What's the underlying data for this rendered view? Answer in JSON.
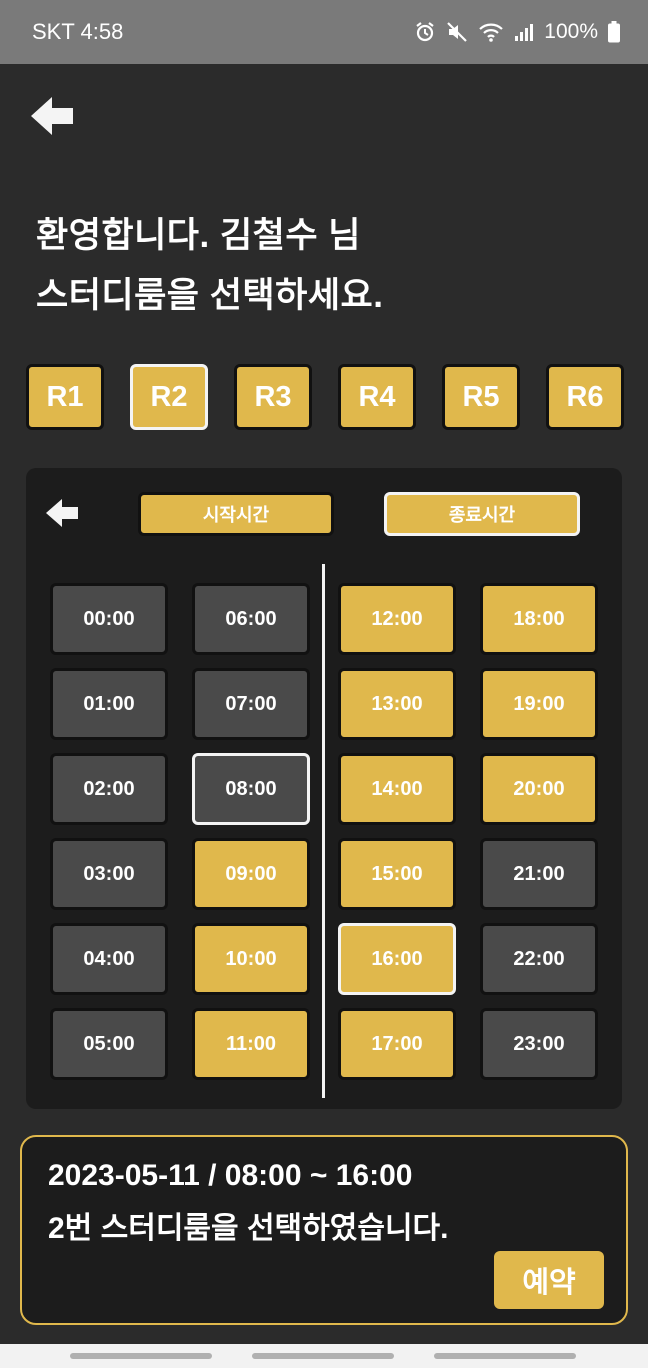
{
  "status_bar": {
    "carrier_time": "SKT 4:58",
    "battery_text": "100%",
    "icons": [
      "alarm-icon",
      "mute-icon",
      "wifi-icon",
      "signal-icon",
      "battery-icon"
    ]
  },
  "header": {
    "back_icon": "arrow-left-icon",
    "welcome_line1": "환영합니다. 김철수 님",
    "welcome_line2": "스터디룸을 선택하세요."
  },
  "rooms": {
    "items": [
      "R1",
      "R2",
      "R3",
      "R4",
      "R5",
      "R6"
    ],
    "selected": "R2"
  },
  "time_panel": {
    "back_icon": "arrow-left-icon",
    "start_tab": "시작시간",
    "end_tab": "종료시간",
    "slots": [
      "00:00",
      "01:00",
      "02:00",
      "03:00",
      "04:00",
      "05:00",
      "06:00",
      "07:00",
      "08:00",
      "09:00",
      "10:00",
      "11:00",
      "12:00",
      "13:00",
      "14:00",
      "15:00",
      "16:00",
      "17:00",
      "18:00",
      "19:00",
      "20:00",
      "21:00",
      "22:00",
      "23:00"
    ],
    "selected_start": "08:00",
    "selected_end": "16:00"
  },
  "summary": {
    "line1": "2023-05-11 / 08:00 ~ 16:00",
    "line2": "2번 스터디룸을 선택하였습니다.",
    "reserve_label": "예약"
  },
  "colors": {
    "accent": "#e0b84c",
    "background": "#2b2b2b",
    "panel": "#1c1c1c",
    "slot_unavailable": "#4a4a4a"
  }
}
